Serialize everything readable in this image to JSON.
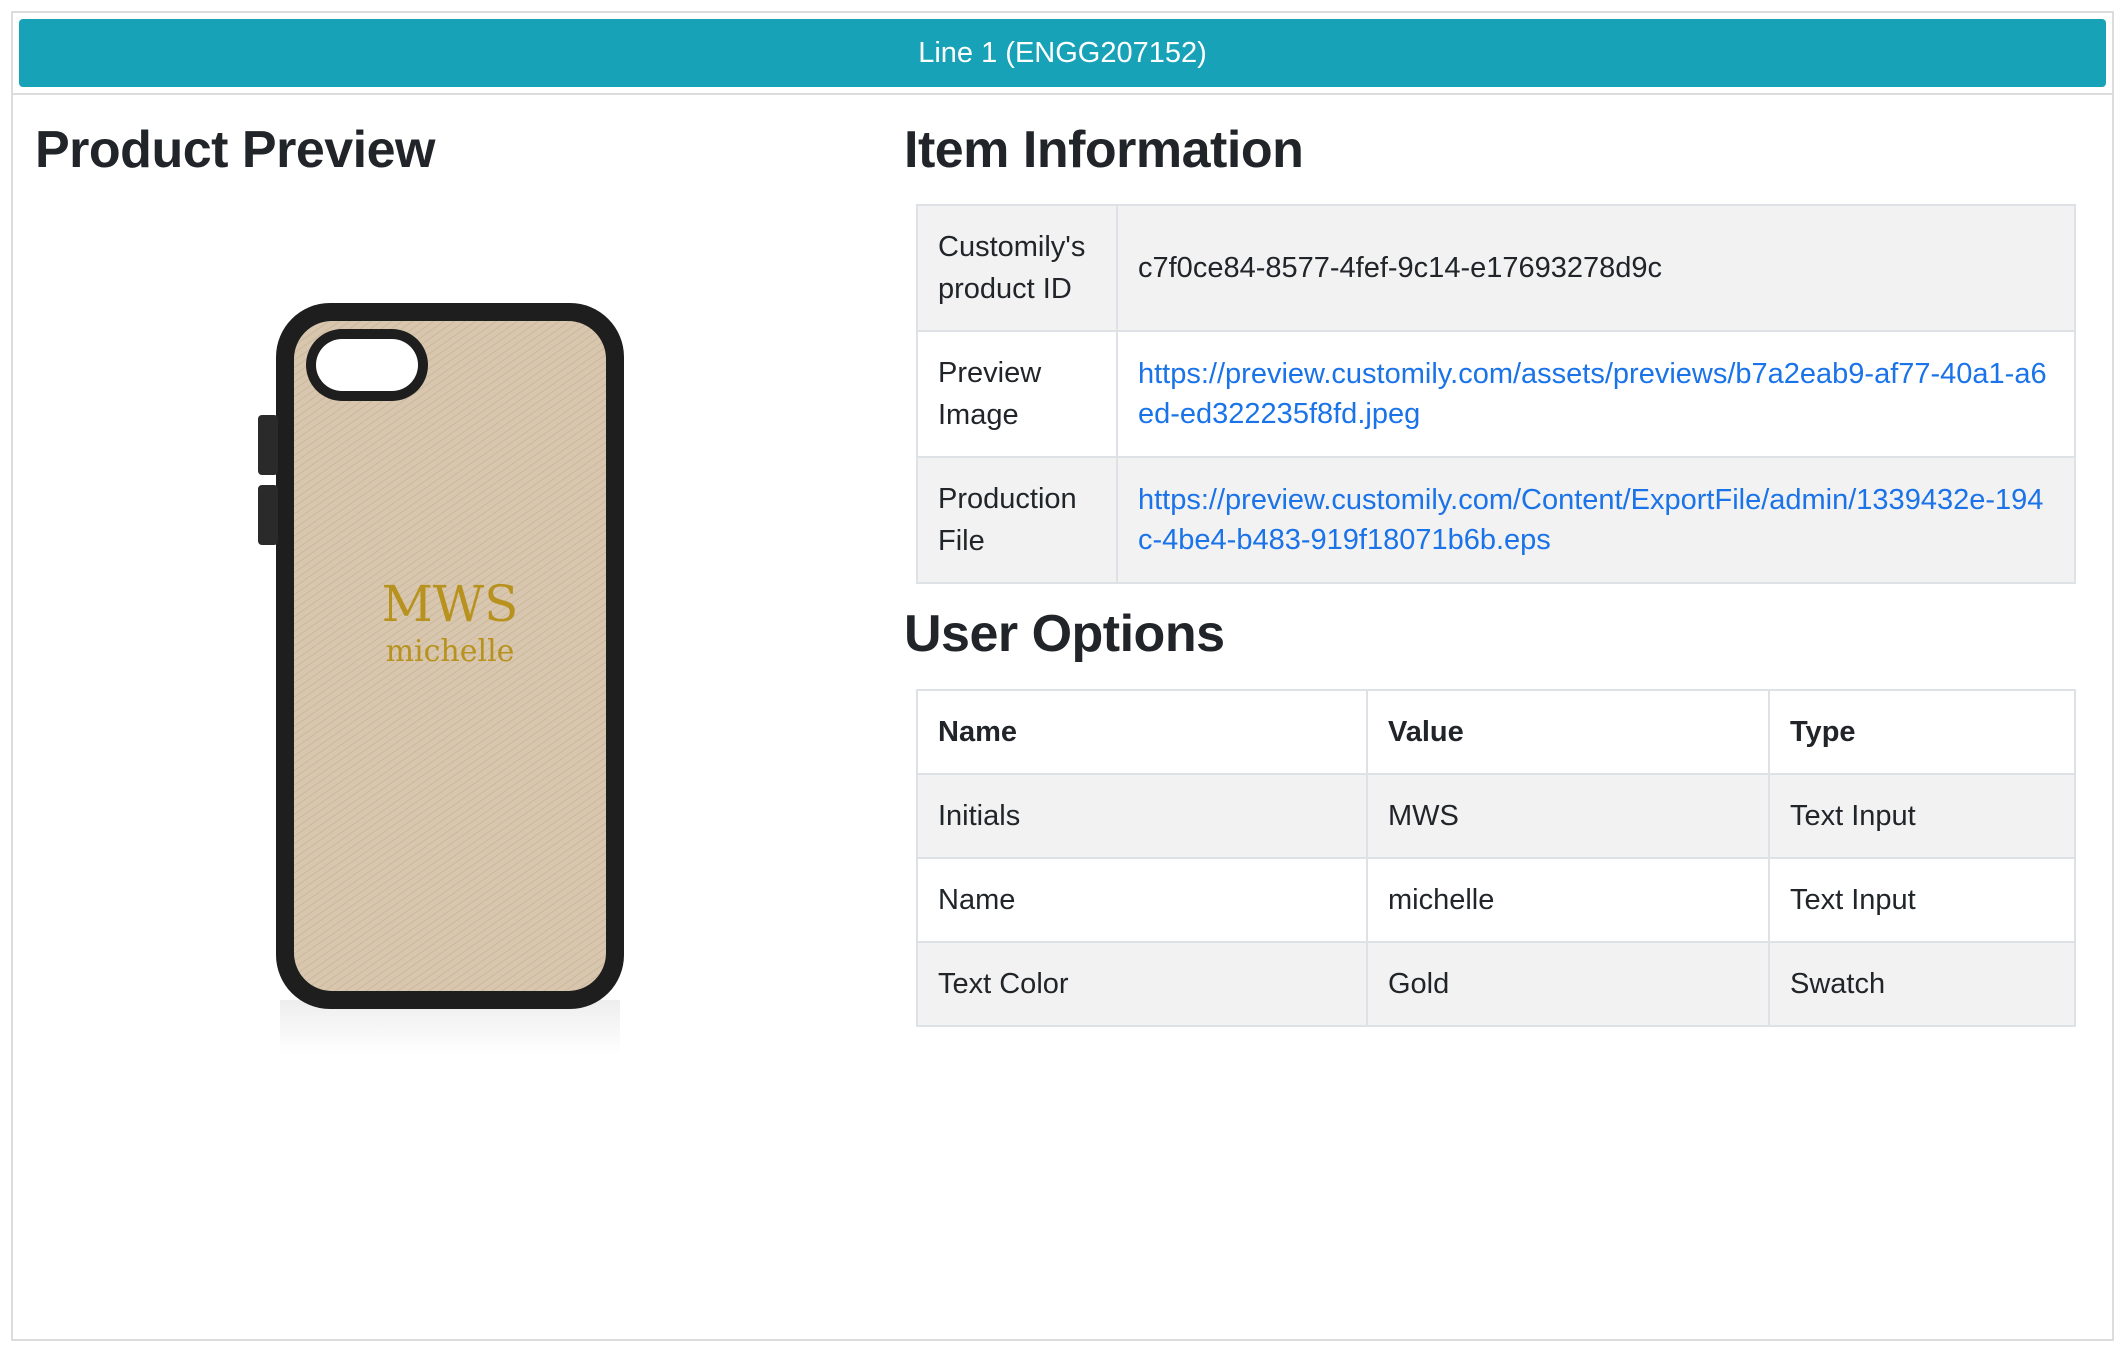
{
  "header": {
    "title": "Line 1 (ENGG207152)"
  },
  "preview": {
    "heading": "Product Preview",
    "image_icon": "phone-case-image",
    "monogram_initials": "MWS",
    "monogram_name": "michelle",
    "colors": {
      "case_body": "#d8c7ae",
      "case_border": "#1e1e1e",
      "monogram_gold": "#b8921e"
    }
  },
  "item_information": {
    "heading": "Item Information",
    "rows": [
      {
        "label": "Customily's product ID",
        "value": "c7f0ce84-8577-4fef-9c14-e17693278d9c",
        "is_link": false
      },
      {
        "label": "Preview Image",
        "value": "https://preview.customily.com/assets/previews/b7a2eab9-af77-40a1-a6ed-ed322235f8fd.jpeg",
        "is_link": true
      },
      {
        "label": "Production File",
        "value": "https://preview.customily.com/Content/ExportFile/admin/1339432e-194c-4be4-b483-919f18071b6b.eps",
        "is_link": true
      }
    ]
  },
  "user_options": {
    "heading": "User Options",
    "columns": [
      "Name",
      "Value",
      "Type"
    ],
    "rows": [
      {
        "name": "Initials",
        "value": "MWS",
        "type": "Text Input"
      },
      {
        "name": "Name",
        "value": "michelle",
        "type": "Text Input"
      },
      {
        "name": "Text Color",
        "value": "Gold",
        "type": "Swatch"
      }
    ]
  },
  "theme": {
    "header_bg": "#17a2b8",
    "link_color": "#1a73e8",
    "stripe_bg": "#f2f2f2"
  }
}
